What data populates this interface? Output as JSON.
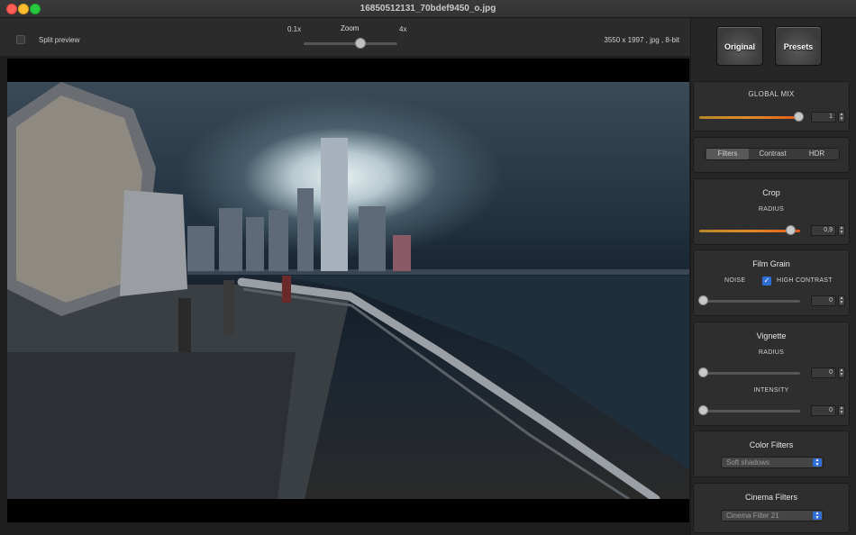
{
  "window": {
    "title": "16850512131_70bdef9450_o.jpg"
  },
  "toolbar": {
    "split_preview_label": "Split preview",
    "zoom": {
      "title": "Zoom",
      "min_label": "0.1x",
      "max_label": "4x",
      "level": 0.5
    },
    "image_info": "3550 x 1997 , jpg , 8-bit"
  },
  "panel": {
    "buttons": {
      "original": "Original",
      "presets": "Presets"
    },
    "global_mix": {
      "label": "GLOBAL MIX",
      "value": "1",
      "fraction": 1.0
    },
    "tabs": [
      {
        "label": "Filters",
        "selected": true
      },
      {
        "label": "Contrast",
        "selected": false
      },
      {
        "label": "HDR",
        "selected": false
      }
    ],
    "crop": {
      "title": "Crop",
      "radius_label": "RADIUS",
      "value": "0,9",
      "fraction": 0.9
    },
    "film_grain": {
      "title": "Film Grain",
      "noise_label": "NOISE",
      "high_contrast_label": "HIGH CONTRAST",
      "high_contrast_checked": true,
      "value": "0",
      "fraction": 0
    },
    "vignette": {
      "title": "Vignette",
      "radius_label": "RADIUS",
      "radius_value": "0",
      "radius_fraction": 0,
      "intensity_label": "INTENSITY",
      "intensity_value": "0",
      "intensity_fraction": 0
    },
    "color_filters": {
      "title": "Color Filters",
      "selected": "Soft shadows"
    },
    "cinema_filters": {
      "title": "Cinema Filters",
      "selected": "Cinema Filter 21"
    }
  },
  "colors": {
    "accent_blue": "#2f6fd6",
    "slider_orange": "#e08a2a"
  }
}
